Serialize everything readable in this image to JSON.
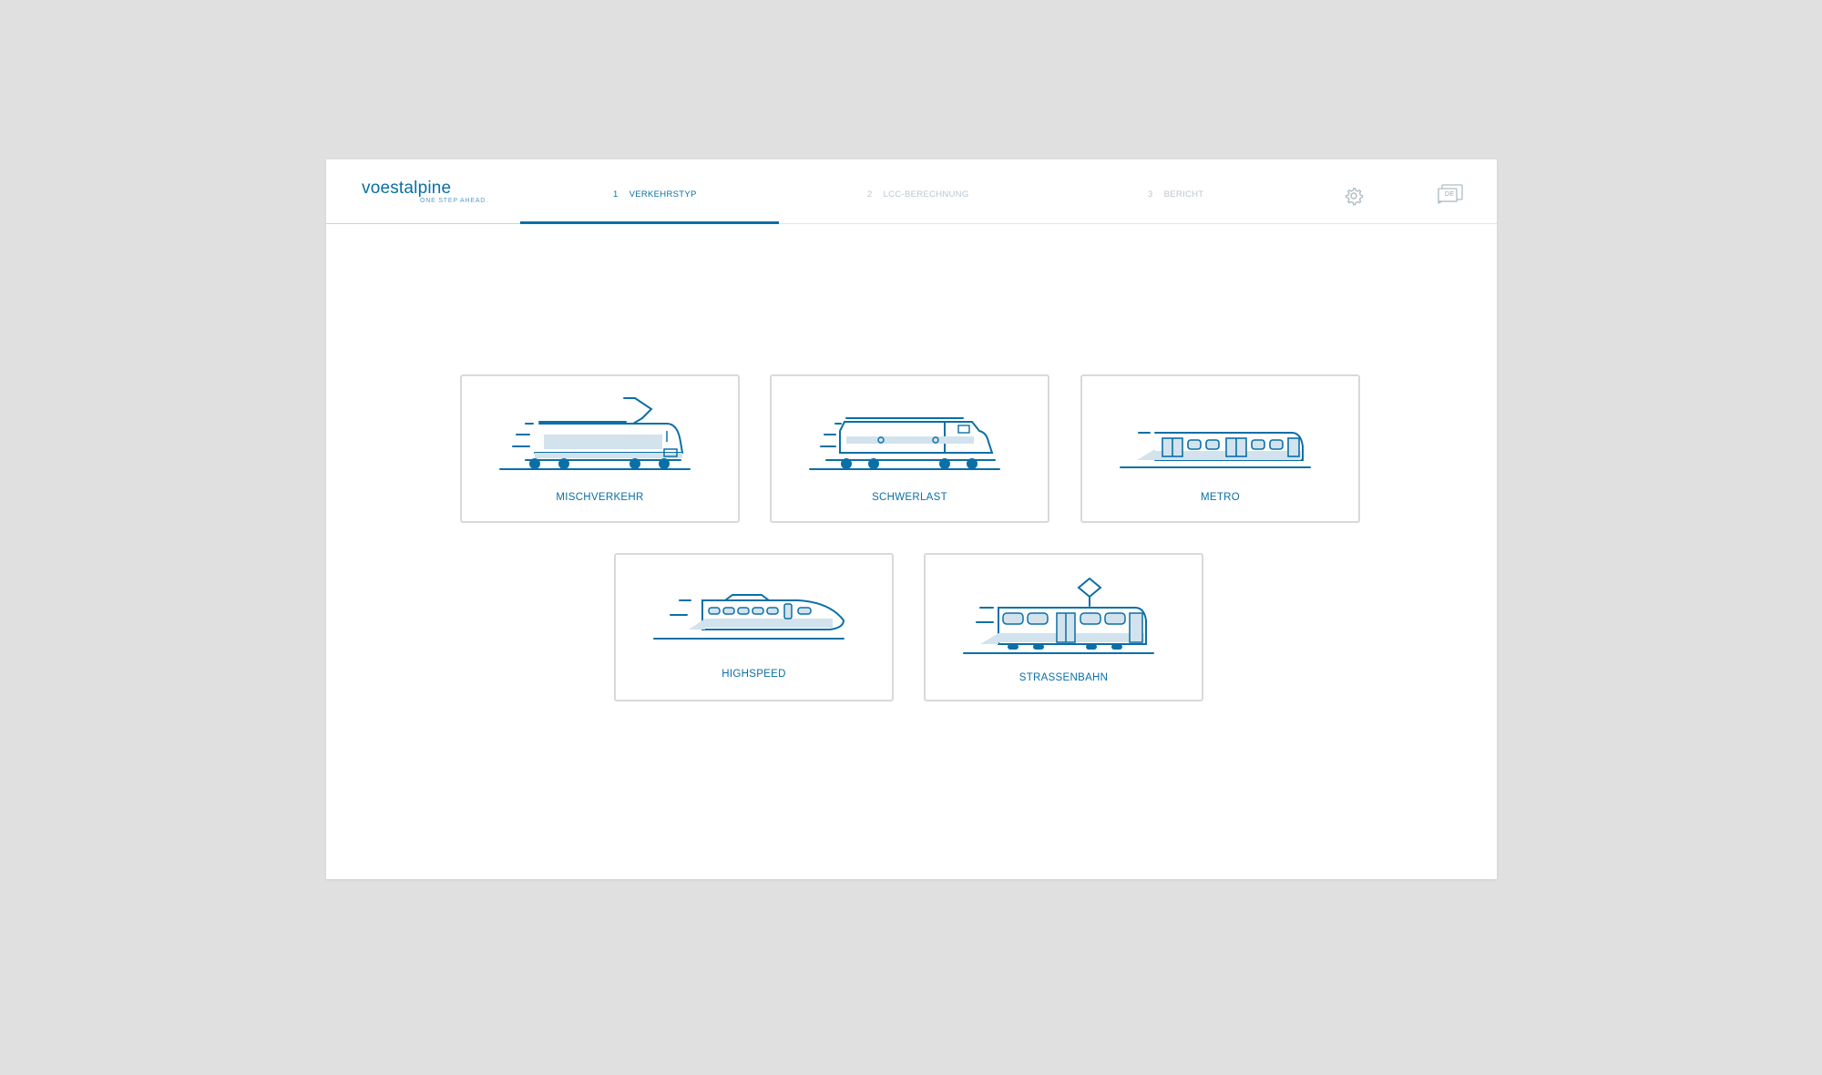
{
  "brand": {
    "name": "voestalpine",
    "tagline": "ONE STEP AHEAD."
  },
  "steps": [
    {
      "number": "1",
      "label": "VERKEHRSTYP",
      "state": "active"
    },
    {
      "number": "2",
      "label": "LCC-BERECHNUNG",
      "state": "inactive"
    },
    {
      "number": "3",
      "label": "BERICHT",
      "state": "inactive"
    }
  ],
  "toolbar": {
    "settings_icon": "gear-icon",
    "language_icon": "language-chat-icon",
    "language_code": "DE"
  },
  "colors": {
    "accent": "#0a6fa6",
    "light_accent": "#d2e3ee",
    "background": "#e0e0e0",
    "card_border": "#d9d9d9"
  },
  "traffic_types": [
    {
      "label": "MISCHVERKEHR",
      "icon": "electric-locomotive-icon"
    },
    {
      "label": "SCHWERLAST",
      "icon": "diesel-locomotive-icon"
    },
    {
      "label": "METRO",
      "icon": "metro-train-icon"
    },
    {
      "label": "HIGHSPEED",
      "icon": "highspeed-train-icon"
    },
    {
      "label": "STRASSENBAHN",
      "icon": "tram-icon"
    }
  ]
}
